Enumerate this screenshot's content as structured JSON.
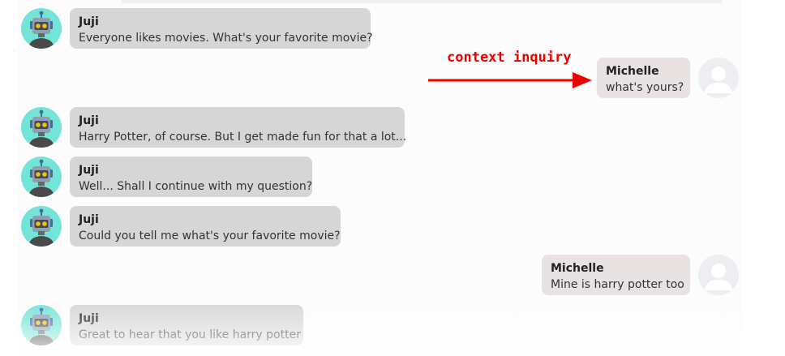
{
  "messages": [
    {
      "sender": "Juji",
      "text": "Everyone likes movies. What's your favorite movie?"
    },
    {
      "sender": "Michelle",
      "text": "what's yours?"
    },
    {
      "sender": "Juji",
      "text": "Harry Potter, of course. But I get made fun for that a lot..."
    },
    {
      "sender": "Juji",
      "text": "Well... Shall I continue with my question?"
    },
    {
      "sender": "Juji",
      "text": "Could you tell me what's your favorite movie?"
    },
    {
      "sender": "Michelle",
      "text": "Mine is harry potter too"
    },
    {
      "sender": "Juji",
      "text": "Great to hear that you like harry potter"
    }
  ],
  "annotation": {
    "label": "context inquiry",
    "color": "#ee0000"
  },
  "colors": {
    "bot_bubble": "#d6d6d6",
    "user_bubble": "#e8e2e2",
    "bot_avatar_bg": "#73e4d8",
    "user_avatar_bg": "#eceef2"
  },
  "icons": {
    "bot_avatar": "robot-icon",
    "user_avatar": "user-silhouette-icon"
  }
}
